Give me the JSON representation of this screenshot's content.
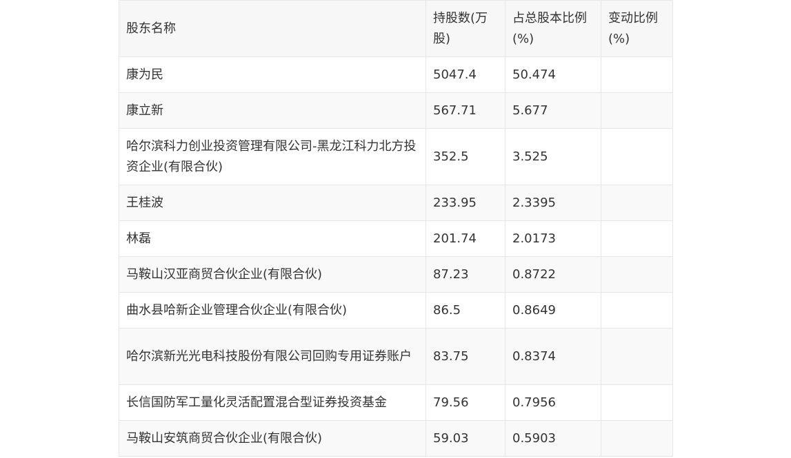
{
  "table": {
    "headers": [
      "股东名称",
      "持股数(万股)",
      "占总股本比例(%)",
      "变动比例(%)"
    ],
    "rows": [
      [
        "康为民",
        "5047.4",
        "50.474",
        ""
      ],
      [
        "康立新",
        "567.71",
        "5.677",
        ""
      ],
      [
        "哈尔滨科力创业投资管理有限公司-黑龙江科力北方投资企业(有限合伙)",
        "352.5",
        "3.525",
        ""
      ],
      [
        "王桂波",
        "233.95",
        "2.3395",
        ""
      ],
      [
        "林磊",
        "201.74",
        "2.0173",
        ""
      ],
      [
        "马鞍山汉亚商贸合伙企业(有限合伙)",
        "87.23",
        "0.8722",
        ""
      ],
      [
        "曲水县哈新企业管理合伙企业(有限合伙)",
        "86.5",
        "0.8649",
        ""
      ],
      [
        "哈尔滨新光光电科技股份有限公司回购专用证券账户",
        "83.75",
        "0.8374",
        ""
      ],
      [
        "长信国防军工量化灵活配置混合型证券投资基金",
        "79.56",
        "0.7956",
        ""
      ],
      [
        "马鞍山安筑商贸合伙企业(有限合伙)",
        "59.03",
        "0.5903",
        ""
      ]
    ]
  }
}
